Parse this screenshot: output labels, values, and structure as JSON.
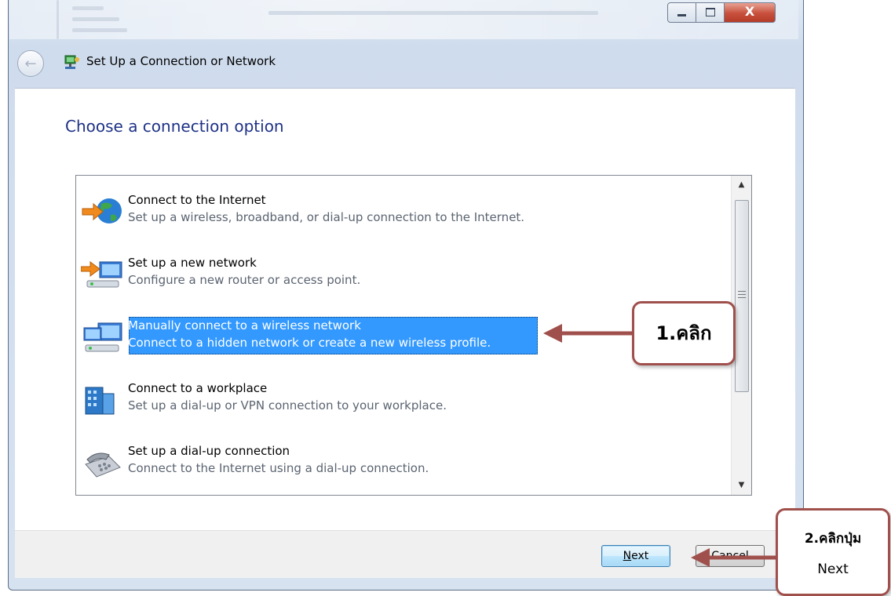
{
  "window": {
    "title": "Set Up a Connection or Network",
    "close_glyph": "X"
  },
  "page": {
    "heading": "Choose a connection option"
  },
  "options": [
    {
      "title": "Connect to the Internet",
      "desc": "Set up a wireless, broadband, or dial-up connection to the Internet.",
      "icon": "globe-internet-icon",
      "selected": false
    },
    {
      "title": "Set up a new network",
      "desc": "Configure a new router or access point.",
      "icon": "new-network-icon",
      "selected": false
    },
    {
      "title": "Manually connect to a wireless network",
      "desc": "Connect to a hidden network or create a new wireless profile.",
      "icon": "wireless-network-icon",
      "selected": true
    },
    {
      "title": "Connect to a workplace",
      "desc": "Set up a dial-up or VPN connection to your workplace.",
      "icon": "workplace-building-icon",
      "selected": false
    },
    {
      "title": "Set up a dial-up connection",
      "desc": "Connect to the Internet using a dial-up connection.",
      "icon": "dialup-phone-icon",
      "selected": false
    }
  ],
  "footer": {
    "next_label_mnemonic": "N",
    "next_label_rest": "ext",
    "cancel_label": "Cancel"
  },
  "annotations": {
    "step1": "1.คลิก",
    "step2_line1": "2.คลิกปุ่ม",
    "step2_line2": "Next",
    "color": "#a0504c"
  }
}
